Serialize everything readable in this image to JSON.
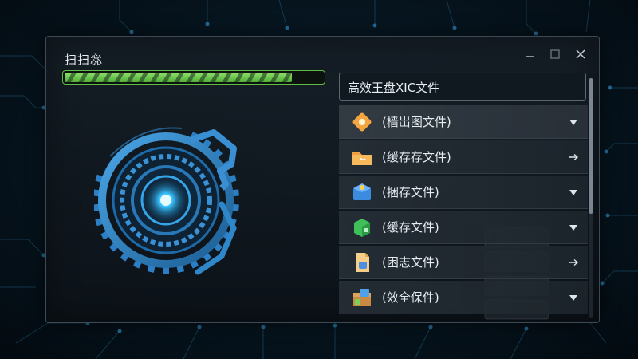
{
  "window": {
    "title": "扫扫惢",
    "controls": [
      "minimize-icon",
      "maximize-icon",
      "close-icon"
    ]
  },
  "scan": {
    "progress": 0.88,
    "progress_color": "#5fbd45"
  },
  "list": {
    "header": "高效王盘XIC文件",
    "items": [
      {
        "label": "(樯岀图文件)",
        "icon": "orange-diamond-icon",
        "action": "chevron-down-icon"
      },
      {
        "label": "(缓存存文件)",
        "icon": "orange-folder-icon",
        "action": "arrow-right-icon"
      },
      {
        "label": "(捆存文件)",
        "icon": "blue-box-icon",
        "action": "chevron-down-icon"
      },
      {
        "label": "(缓存文件)",
        "icon": "green-cube-icon",
        "action": "chevron-down-icon"
      },
      {
        "label": "(困志文件)",
        "icon": "document-icon",
        "action": "arrow-right-icon"
      },
      {
        "label": "(效全保件)",
        "icon": "package-icon",
        "action": "chevron-down-icon"
      }
    ]
  },
  "colors": {
    "accent_blue": "#2f8fd8",
    "glow_blue": "#39c2ff",
    "progress_green": "#5fbd45"
  }
}
